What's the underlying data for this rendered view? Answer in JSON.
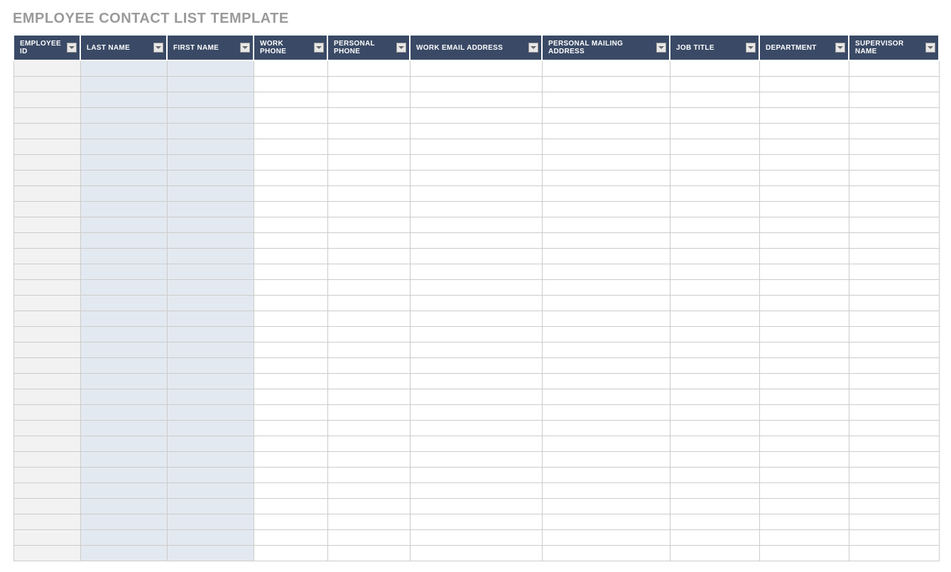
{
  "title": "EMPLOYEE CONTACT LIST TEMPLATE",
  "columns": {
    "employee_id": "EMPLOYEE ID",
    "last_name": "LAST NAME",
    "first_name": "FIRST NAME",
    "work_phone": "WORK PHONE",
    "personal_phone": "PERSONAL PHONE",
    "work_email": "WORK EMAIL ADDRESS",
    "mailing": "PERSONAL MAILING ADDRESS",
    "job_title": "JOB TITLE",
    "department": "DEPARTMENT",
    "supervisor": "SUPERVISOR NAME"
  },
  "row_count": 32
}
